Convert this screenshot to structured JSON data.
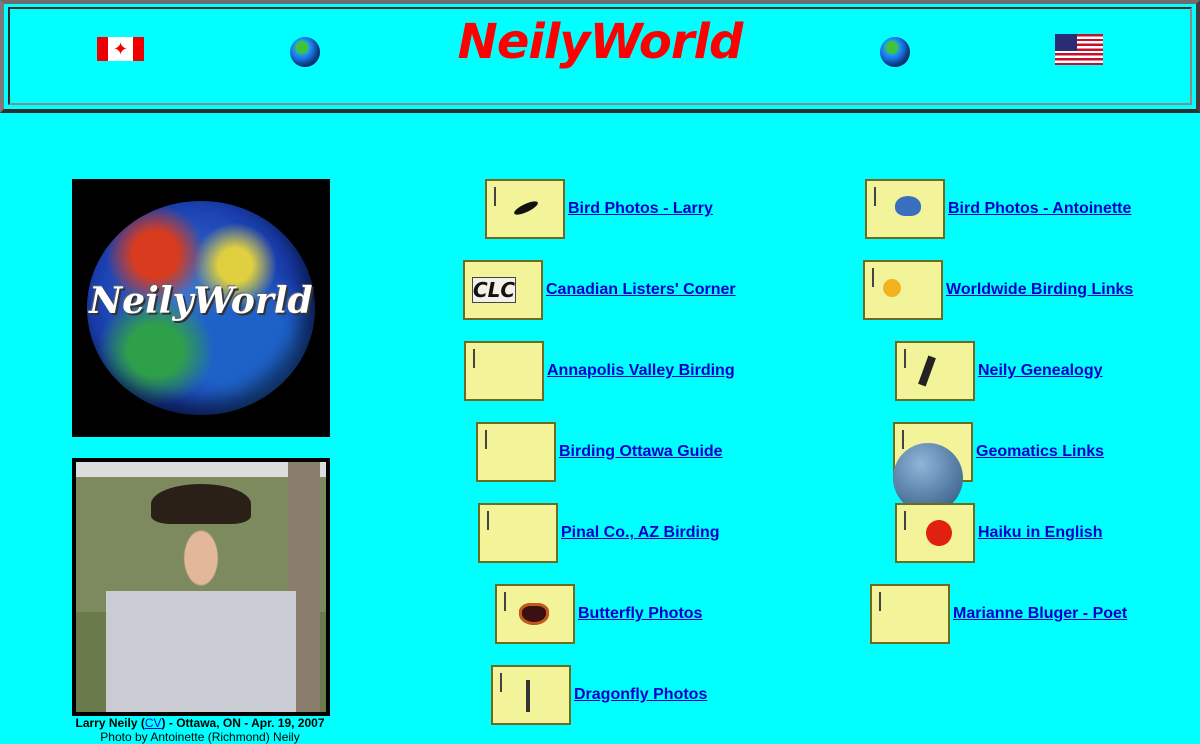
{
  "header": {
    "title": "NeilyWorld",
    "flag_left": "canada-flag",
    "flag_right": "usa-flag"
  },
  "sidebar": {
    "logo_text": "NeilyWorld",
    "caption": {
      "name": "Larry Neily",
      "cv_link": "CV",
      "place_date": " - Ottawa, ON - Apr. 19, 2007",
      "credit": "Photo by Antoinette (Richmond) Neily"
    }
  },
  "links_left": [
    {
      "label": " Bird Photos - Larry",
      "thumb": "bird-photo"
    },
    {
      "label": " Canadian Listers' Corner",
      "thumb": "clc-logo",
      "thumb_text": "CLC"
    },
    {
      "label": " Annapolis Valley Birding",
      "thumb": "river-photo"
    },
    {
      "label": " Birding Ottawa Guide",
      "thumb": "ottawa-photo"
    },
    {
      "label": " Pinal Co., AZ Birding",
      "thumb": "desert-rock-photo"
    },
    {
      "label": " Butterfly Photos",
      "thumb": "butterfly-photo"
    },
    {
      "label": " Dragonfly Photos",
      "thumb": "dragonfly-photo"
    }
  ],
  "links_right": [
    {
      "label": " Bird Photos - Antoinette",
      "thumb": "bluejay-photo"
    },
    {
      "label": " Worldwide Birding Links",
      "thumb": "sun-birds-icon"
    },
    {
      "label": " Neily Genealogy",
      "thumb": "genealogy-icon"
    },
    {
      "label": " Geomatics Links",
      "thumb": "earth-space-photo"
    },
    {
      "label": " Haiku in English",
      "thumb": "japan-flag"
    },
    {
      "label": " Marianne Bluger - Poet",
      "thumb": "poet-portrait"
    }
  ]
}
